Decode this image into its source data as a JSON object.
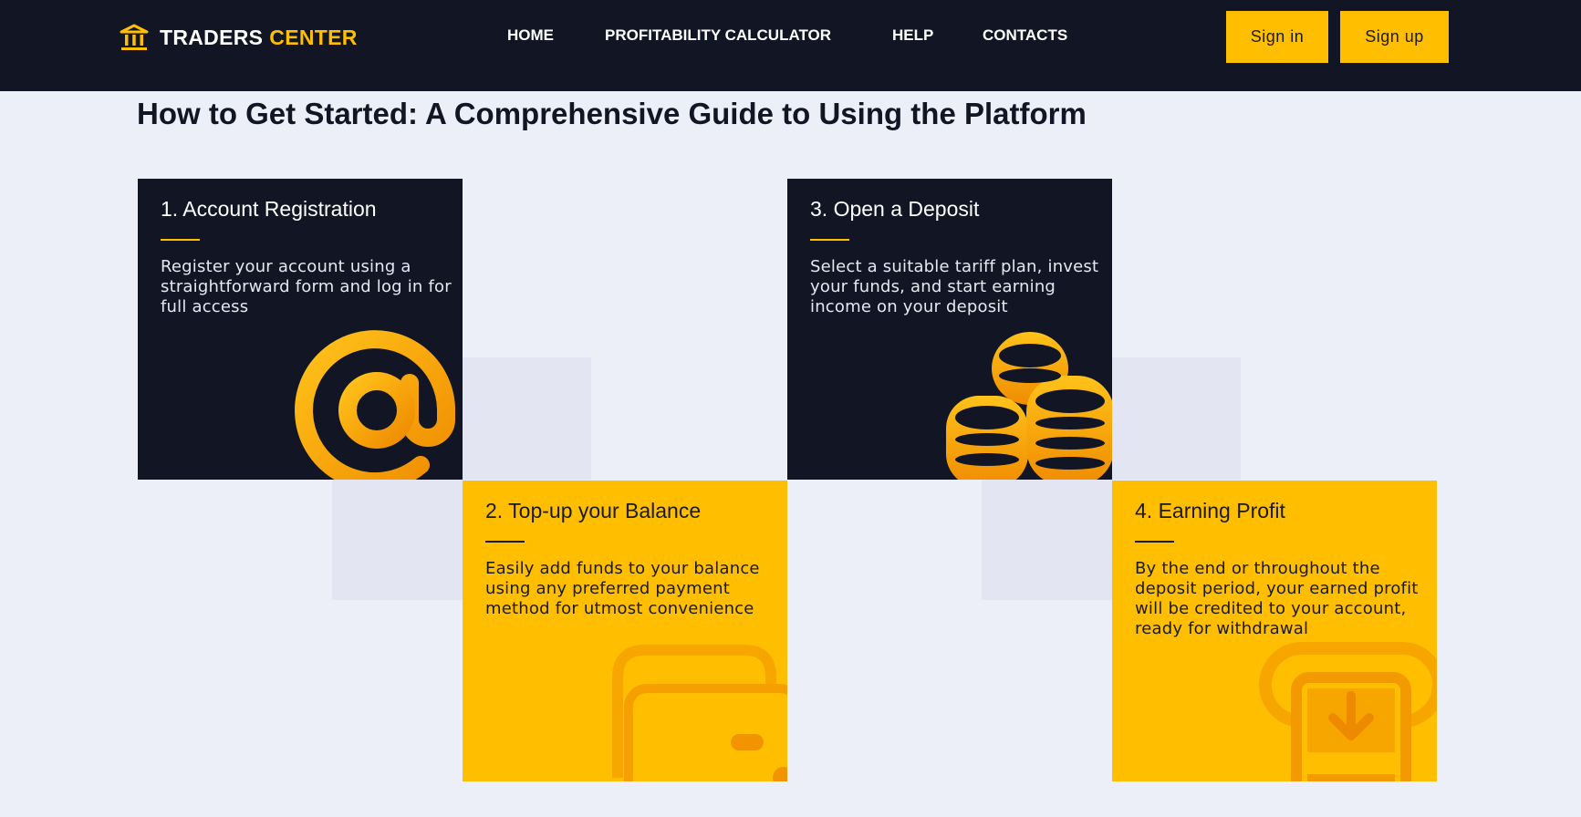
{
  "header": {
    "brand_part1": "TRADERS",
    "brand_part2": "CENTER",
    "logo_icon": "bank-building-icon",
    "nav": [
      "HOME",
      "PROFITABILITY CALCULATOR",
      "HELP",
      "CONTACTS"
    ],
    "sign_in": "Sign in",
    "sign_up": "Sign up"
  },
  "main": {
    "title": "How to Get Started: A Comprehensive Guide to Using the Platform",
    "steps": [
      {
        "title": "1. Account Registration",
        "text": "Register your account using a straightforward form and log in for full access",
        "icon": "at-sign-icon"
      },
      {
        "title": "2. Top-up your Balance",
        "text": "Easily add funds to your balance using any preferred payment method for utmost convenience",
        "icon": "wallet-icon"
      },
      {
        "title": "3. Open a Deposit",
        "text": "Select a suitable tariff plan, invest your funds, and start earning income on your deposit",
        "icon": "coin-stacks-icon"
      },
      {
        "title": "4. Earning Profit",
        "text": "By the end or throughout the deposit period, your earned profit will be credited to your account, ready for withdrawal",
        "icon": "withdraw-icon"
      }
    ]
  },
  "colors": {
    "accent": "#ffbf00",
    "dark": "#121624",
    "background": "#edeff8"
  }
}
